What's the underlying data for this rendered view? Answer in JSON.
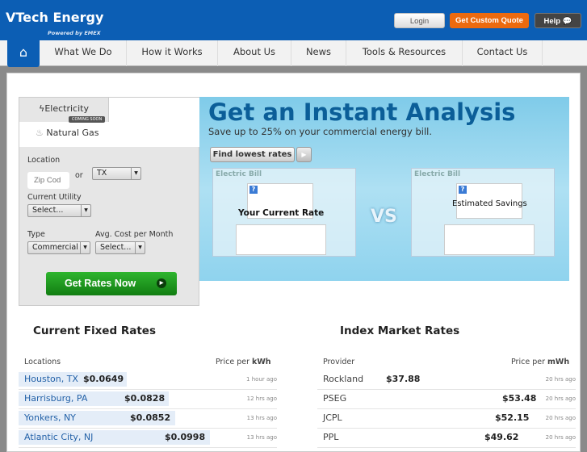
{
  "header": {
    "brand": "VTech Energy",
    "powered": "Powered by EMEX",
    "login": "Login",
    "quote": "Get Custom Quote",
    "help": "Help"
  },
  "nav": {
    "items": [
      "What We Do",
      "How it Works",
      "About Us",
      "News",
      "Tools & Resources",
      "Contact Us"
    ]
  },
  "form": {
    "tab_electricity": "Electricity",
    "tab_gas": "Natural Gas",
    "coming_soon": "COMING SOON",
    "location_label": "Location",
    "zip_placeholder": "Zip Cod",
    "or": "or",
    "state": "TX",
    "utility_label": "Current Utility",
    "utility": "Select...",
    "type_label": "Type",
    "type": "Commercial",
    "cost_label": "Avg. Cost per Month",
    "cost": "Select...",
    "submit": "Get Rates Now"
  },
  "banner": {
    "title": "Get an Instant Analysis",
    "subtitle": "Save up to 25% on your commercial energy bill.",
    "find": "Find lowest rates",
    "bill": "Electric Bill",
    "current": "Your Current Rate",
    "vs": "VS",
    "savings": "Estimated Savings"
  },
  "fixed": {
    "title": "Current Fixed Rates",
    "col1": "Locations",
    "col2": "Price per ",
    "unit": "kWh",
    "rows": [
      {
        "loc": "Houston, TX",
        "price": "$0.0649",
        "ago": "1 hour ago"
      },
      {
        "loc": "Harrisburg, PA",
        "price": "$0.0828",
        "ago": "12 hrs ago"
      },
      {
        "loc": "Yonkers, NY",
        "price": "$0.0852",
        "ago": "13 hrs ago"
      },
      {
        "loc": "Atlantic City, NJ",
        "price": "$0.0998",
        "ago": "13 hrs ago"
      }
    ]
  },
  "index": {
    "title": "Index Market Rates",
    "col1": "Provider",
    "col2": "Price per ",
    "unit": "mWh",
    "rows": [
      {
        "prov": "Rockland",
        "price": "$37.88",
        "ago": "20 hrs ago"
      },
      {
        "prov": "PSEG",
        "price": "$53.48",
        "ago": "20 hrs ago"
      },
      {
        "prov": "JCPL",
        "price": "$52.15",
        "ago": "20 hrs ago"
      },
      {
        "prov": "PPL",
        "price": "$49.62",
        "ago": "20 hrs ago"
      }
    ]
  }
}
